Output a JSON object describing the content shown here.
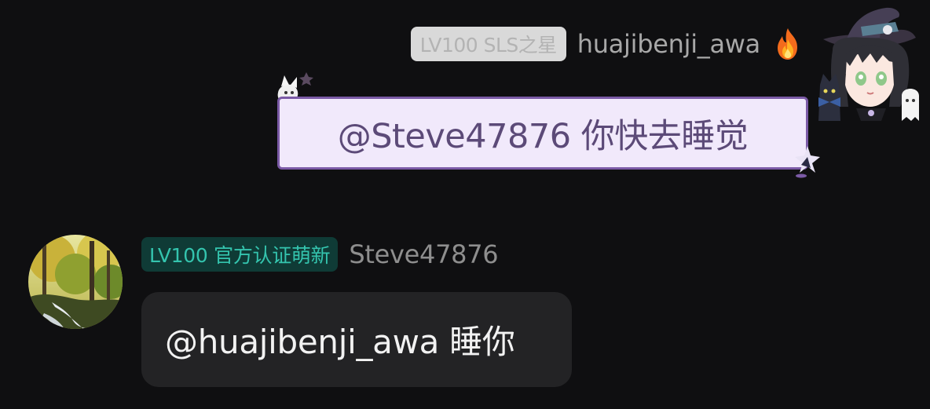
{
  "messages": {
    "outgoing": {
      "badge": "LV100 SLS之星",
      "username": "huajibenji_awa",
      "text": "@Steve47876 你快去睡觉",
      "bubble_color": "#f1e9fb",
      "border_color": "#7b5aa6",
      "decorations": [
        "fire-icon",
        "sparkle-character-decoration",
        "star-decoration",
        "witch-girl-avatar"
      ]
    },
    "incoming": {
      "badge": "LV100 官方认证萌新",
      "username": "Steve47876",
      "text": "@huajibenji_awa 睡你",
      "badge_color": "#34c4ae",
      "avatar": "forest-waterfall-avatar"
    }
  },
  "theme": {
    "background": "#0f0f11"
  }
}
